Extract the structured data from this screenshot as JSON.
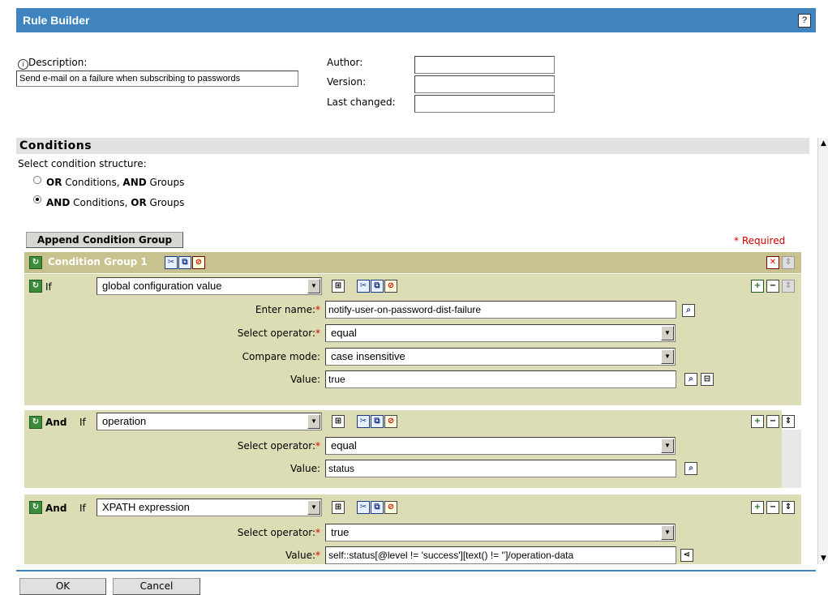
{
  "app": {
    "title": "Rule Builder",
    "help_label": "?"
  },
  "info": {
    "description_label": "Description:",
    "description_value": "Send e-mail on a failure when subscribing to passwords",
    "author_label": "Author:",
    "author_value": "",
    "version_label": "Version:",
    "version_value": "",
    "last_changed_label": "Last changed:",
    "last_changed_value": ""
  },
  "conditions": {
    "header": "Conditions",
    "structure_label": "Select condition structure:",
    "option_or": {
      "b1": "OR",
      "t1": " Conditions, ",
      "b2": "AND",
      "t2": " Groups",
      "selected": false
    },
    "option_and": {
      "b1": "AND",
      "t1": " Conditions, ",
      "b2": "OR",
      "t2": " Groups",
      "selected": true
    },
    "append_button": "Append Condition Group",
    "required_note": "* Required",
    "group_title": "Condition Group 1"
  },
  "rows": [
    {
      "prefix": "",
      "if_label": "If",
      "type": "global configuration value",
      "fields": [
        {
          "label": "Enter name:",
          "required": true,
          "value": "notify-user-on-password-dist-failure",
          "kind": "text"
        },
        {
          "label": "Select operator:",
          "required": true,
          "value": "equal",
          "kind": "select"
        },
        {
          "label": "Compare mode:",
          "required": false,
          "value": "case insensitive",
          "kind": "select"
        },
        {
          "label": "Value:",
          "required": false,
          "value": "true",
          "kind": "text"
        }
      ]
    },
    {
      "prefix": "And",
      "if_label": "If",
      "type": "operation",
      "fields": [
        {
          "label": "Select operator:",
          "required": true,
          "value": "equal",
          "kind": "select"
        },
        {
          "label": "Value:",
          "required": false,
          "value": "status",
          "kind": "text"
        }
      ]
    },
    {
      "prefix": "And",
      "if_label": "If",
      "type": "XPATH expression",
      "fields": [
        {
          "label": "Select operator:",
          "required": true,
          "value": "true",
          "kind": "select"
        },
        {
          "label": "Value:",
          "required": true,
          "value": "self::status[@level != 'success'][text() != '']/operation-data",
          "kind": "text"
        }
      ]
    }
  ],
  "footer": {
    "ok": "OK",
    "cancel": "Cancel"
  },
  "colors": {
    "titlebar": "#3f84bf",
    "group_bar": "#c7c28e",
    "panel": "#ddddb5",
    "required": "#d00000"
  }
}
